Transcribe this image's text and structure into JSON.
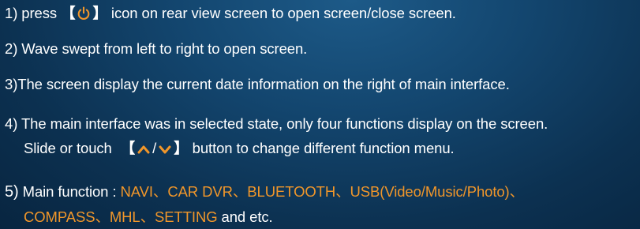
{
  "items": {
    "l1": {
      "prefix": "1) press ",
      "bracket_open": "【",
      "icon": "power-icon",
      "bracket_close": "】",
      "suffix": " icon on rear view screen to open screen/close screen."
    },
    "l2": "2) Wave swept from left to right to open screen.",
    "l3": "3)The screen display the current date information on the right of main interface.",
    "l4a": "4) The main interface was in selected state, only four functions display on the screen.",
    "l4b": {
      "prefix": "Slide or touch ",
      "bracket_open": "【",
      "icons": [
        "chevron-up-icon",
        "chevron-down-icon"
      ],
      "slash": "/",
      "bracket_close": "】",
      "suffix": " button to change different function menu."
    },
    "l5a": {
      "number": "5)",
      "label": " Main function : ",
      "functions": [
        "NAVI",
        "CAR DVR",
        "BLUETOOTH",
        "USB(Video/Music/Photo)"
      ],
      "separator": "、"
    },
    "l5b": {
      "functions": [
        "COMPASS",
        "MHL",
        "SETTING"
      ],
      "separator": "、",
      "suffix": " and etc."
    }
  },
  "colors": {
    "text": "#ffffff",
    "accent": "#f0962a",
    "background": "#13466f"
  }
}
